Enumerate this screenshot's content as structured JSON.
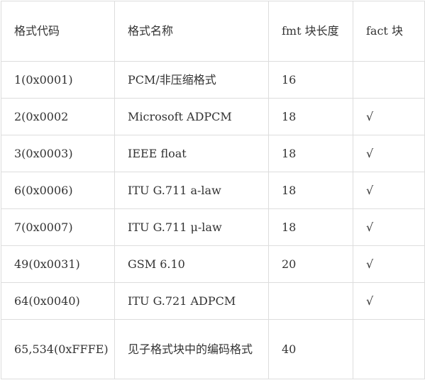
{
  "table": {
    "headers": [
      "格式代码",
      "格式名称",
      "fmt 块长度",
      "fact 块"
    ],
    "rows": [
      {
        "code": "1(0x0001)",
        "name": "PCM/非压缩格式",
        "fmt_len": "16",
        "fact": ""
      },
      {
        "code": "2(0x0002",
        "name": "Microsoft ADPCM",
        "fmt_len": "18",
        "fact": "√"
      },
      {
        "code": "3(0x0003)",
        "name": "IEEE float",
        "fmt_len": "18",
        "fact": "√"
      },
      {
        "code": "6(0x0006)",
        "name": "ITU G.711 a-law",
        "fmt_len": "18",
        "fact": "√"
      },
      {
        "code": "7(0x0007)",
        "name": "ITU G.711 μ-law",
        "fmt_len": "18",
        "fact": "√"
      },
      {
        "code": "49(0x0031)",
        "name": "GSM 6.10",
        "fmt_len": "20",
        "fact": "√"
      },
      {
        "code": "64(0x0040)",
        "name": "ITU G.721 ADPCM",
        "fmt_len": "",
        "fact": "√"
      },
      {
        "code": "65,534(0xFFFE)",
        "name": "见子格式块中的编码格式",
        "fmt_len": "40",
        "fact": ""
      }
    ]
  }
}
